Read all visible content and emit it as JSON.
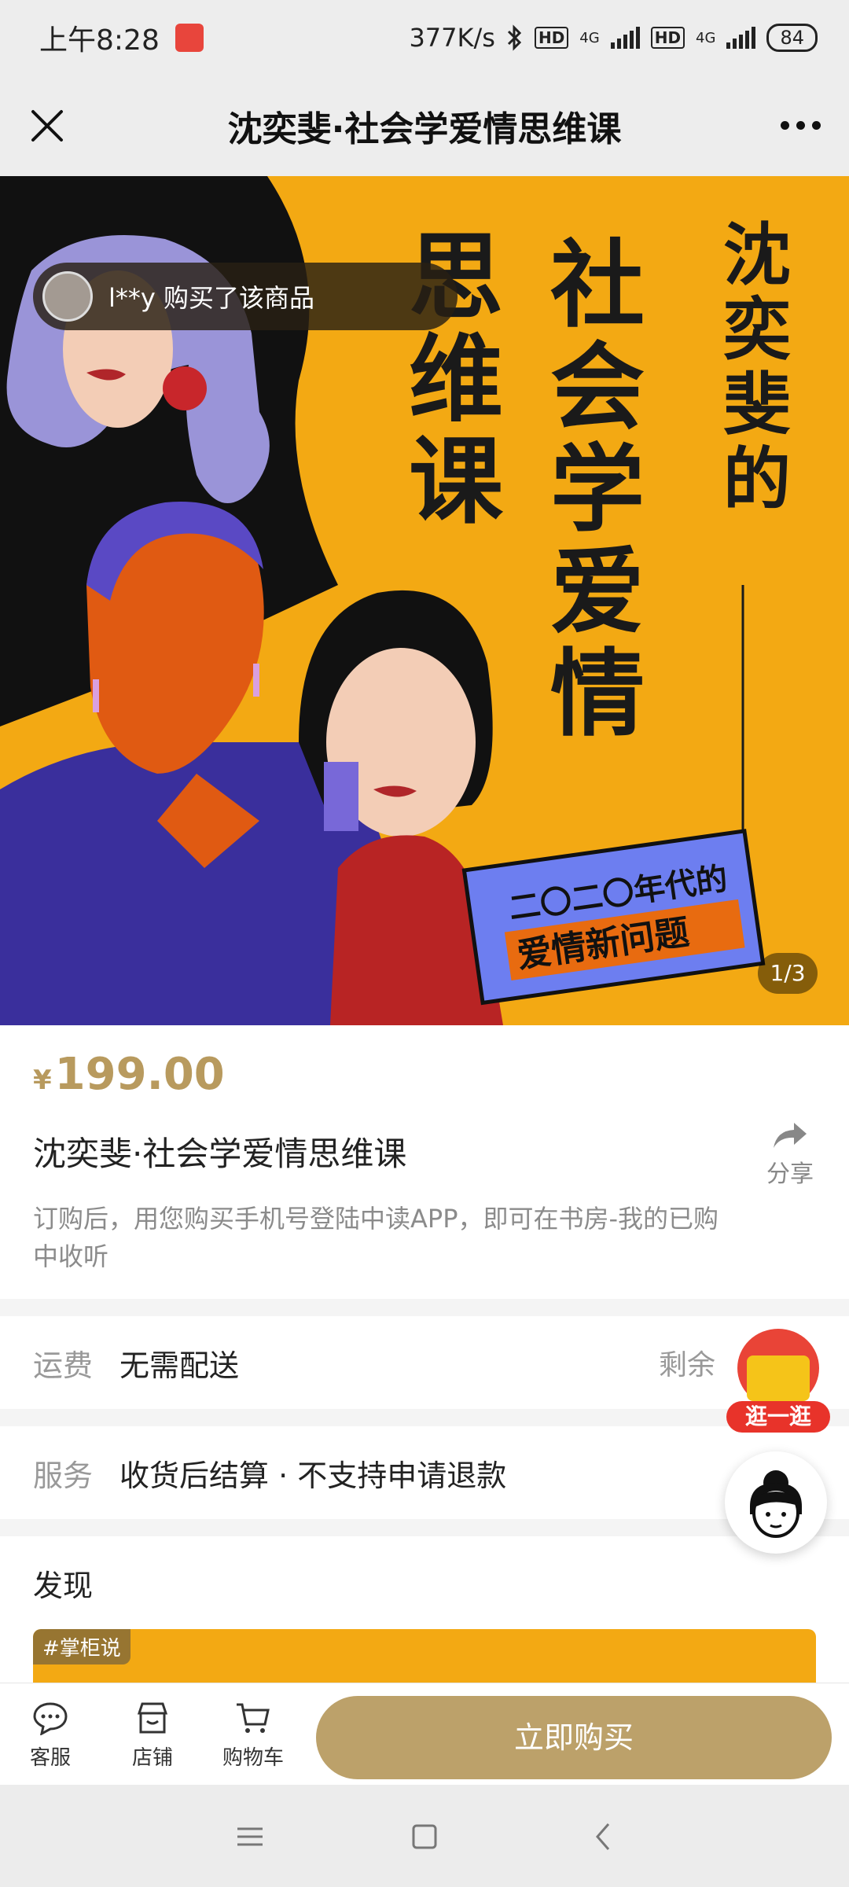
{
  "status_bar": {
    "time": "上午8:28",
    "net_speed": "377K/s",
    "hd1": "HD",
    "net1": "4G",
    "hd2": "HD",
    "net2": "4G",
    "battery": "84"
  },
  "header": {
    "title": "沈奕斐·社会学爱情思维课",
    "close_icon": "close-icon",
    "more_icon": "more-icon"
  },
  "hero": {
    "buyer_message": "l**y 购买了该商品",
    "image_counter": "1/3",
    "cover_title": "沈奕斐的社会学爱情思维课",
    "cover_title_lines": [
      "沈奕斐的",
      "社会学爱情",
      "思维课"
    ],
    "cover_subtitle_1": "二〇二〇年代的",
    "cover_subtitle_2": "爱情新问题"
  },
  "product": {
    "currency": "¥",
    "price": "199.00",
    "title": "沈奕斐·社会学爱情思维课",
    "share_label": "分享",
    "description": "订购后，用您购买手机号登陆中读APP，即可在书房-我的已购中收听"
  },
  "shipping": {
    "label": "运费",
    "value": "无需配送",
    "stock": "剩余"
  },
  "service": {
    "label": "服务",
    "value": "收货后结算 · 不支持申请退款"
  },
  "discover": {
    "title": "发现",
    "tag": "#掌柜说"
  },
  "floating": {
    "stroll_label": "逛一逛"
  },
  "bottom_bar": {
    "customer_service": "客服",
    "store": "店铺",
    "cart": "购物车",
    "buy_now": "立即购买"
  },
  "colors": {
    "accent_gold": "#bca16a",
    "price_gold": "#b89a5e",
    "cover_orange": "#f3a913"
  }
}
